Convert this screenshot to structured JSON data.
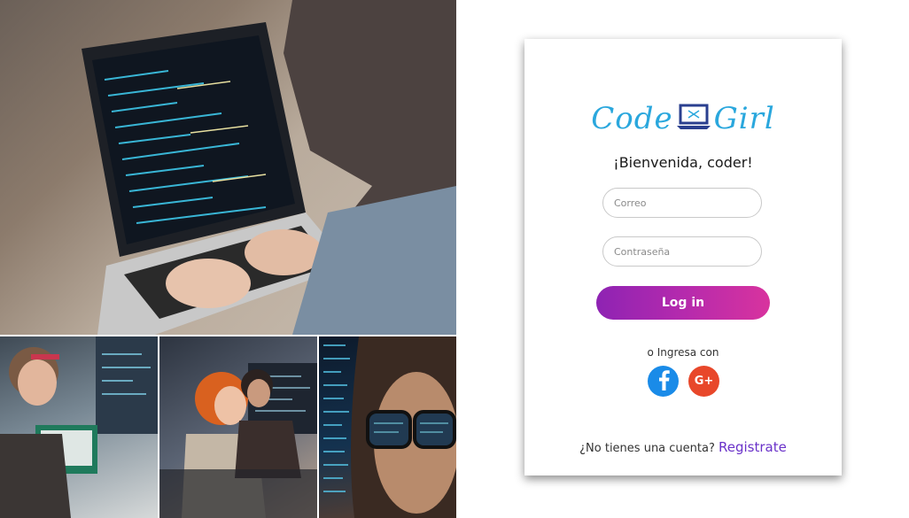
{
  "colors": {
    "logo": "#2aa7dd",
    "button_start": "#8e23b3",
    "button_end": "#d8339e",
    "register_link": "#6a32c9",
    "facebook": "#1a8be8",
    "google": "#e8472a"
  },
  "logo": {
    "left_word": "Code",
    "right_word": "Girl",
    "icon": "laptop-icon"
  },
  "welcome": "¡Bienvenida, coder!",
  "form": {
    "email_placeholder": "Correo",
    "password_placeholder": "Contraseña",
    "login_label": "Log in"
  },
  "social": {
    "prompt": "o Ingresa con",
    "facebook_icon": "facebook-icon",
    "google_icon": "google-plus-icon",
    "google_glyph": "G+"
  },
  "register": {
    "prompt": "¿No tienes una cuenta?",
    "link": "Registrate"
  }
}
